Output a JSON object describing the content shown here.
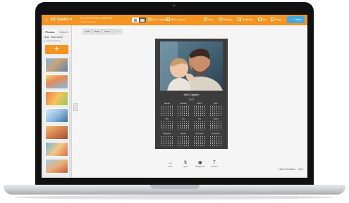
{
  "app": {
    "title": "EZ Studio",
    "project_name": "My 2017 Poster Calendar",
    "project_subtitle": "Poster Calendar",
    "accent_color": "#f5941e",
    "order_color": "#3fa9e6"
  },
  "toolbar": {
    "back_icon": "chevron-left-icon",
    "view_toggle_icons": [
      "single-page-icon",
      "spread-view-icon"
    ],
    "buttons": [
      {
        "label": "Hide Captions",
        "icon": "eye-icon"
      },
      {
        "label": "Photo Layout",
        "icon": "layout-icon"
      },
      {
        "label": "Book",
        "icon": "book-icon"
      },
      {
        "label": "Settings",
        "icon": "gear-icon"
      },
      {
        "label": "Templates",
        "icon": "template-icon"
      },
      {
        "label": "Sort",
        "icon": "sort-icon"
      },
      {
        "label": "Share",
        "icon": "share-icon"
      }
    ],
    "order_label": "Order",
    "order_icon": "cart-icon"
  },
  "sidebar": {
    "tabs": [
      "Photos",
      "Clipart"
    ],
    "links": [
      "Add",
      "View Used"
    ],
    "count_text": "1 / 20 of 3 photos",
    "add_label": "+",
    "thumbnails": [
      "photo-thumbnail-1",
      "photo-thumbnail-2",
      "photo-thumbnail-3",
      "photo-thumbnail-4",
      "photo-thumbnail-5",
      "photo-thumbnail-6",
      "photo-thumbnail-7"
    ]
  },
  "canvas_toolbar": [
    "Undo",
    "Redo",
    "Undo",
    "Redo"
  ],
  "calendar": {
    "caption": "Add Caption",
    "year": "2017",
    "months": [
      "January",
      "February",
      "March",
      "April",
      "May",
      "June",
      "July",
      "August",
      "September",
      "October",
      "November",
      "December"
    ]
  },
  "bottom_tools": [
    {
      "label": "Zoom",
      "icon": "zoom-arrows-icon"
    },
    {
      "label": "Layout",
      "icon": "arrows-icon"
    },
    {
      "label": "Background",
      "icon": "image-icon"
    },
    {
      "label": "Add Text",
      "icon": "text-icon"
    }
  ],
  "footer": {
    "feedback": "Leave Feedback",
    "help": "Help"
  }
}
